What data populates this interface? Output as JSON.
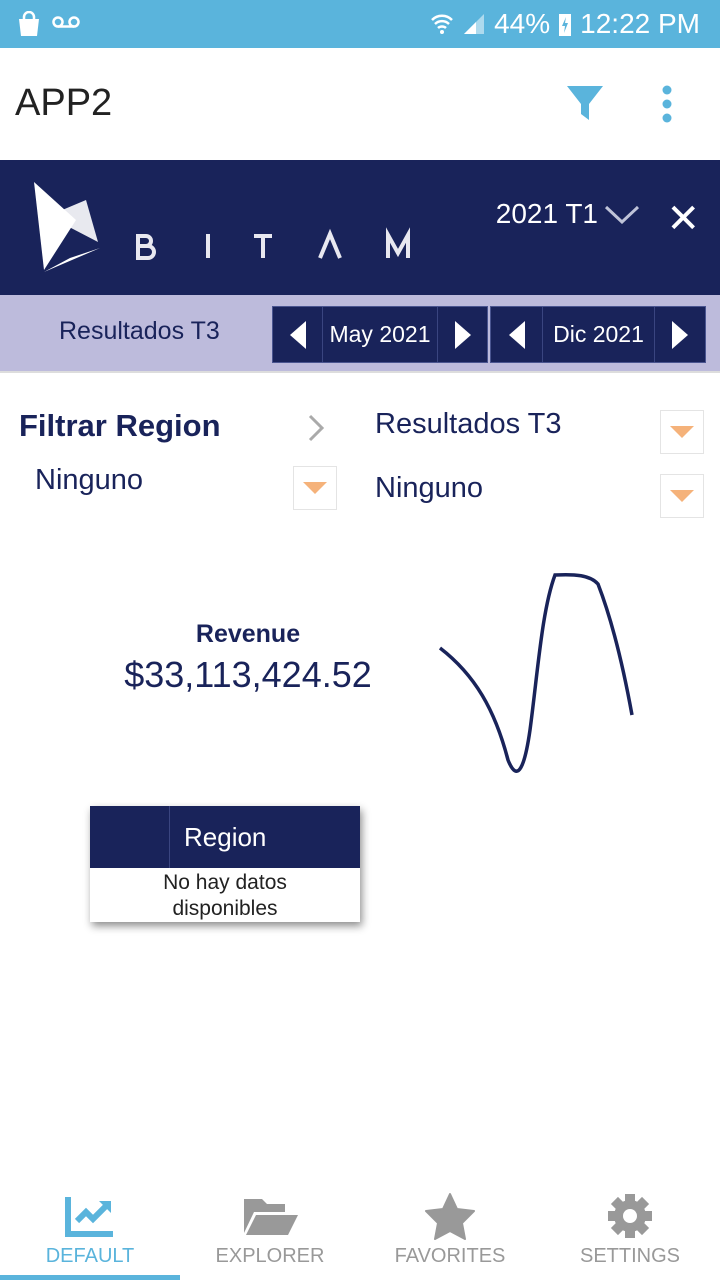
{
  "status": {
    "battery": "44%",
    "time": "12:22 PM",
    "icons": [
      "shopping-bag-icon",
      "voicemail-icon",
      "wifi-icon",
      "signal-icon",
      "battery-charging-icon"
    ]
  },
  "appbar": {
    "title": "APP2",
    "icons": [
      "filter-icon",
      "more-vert-icon"
    ]
  },
  "banner": {
    "logo_text": "BITAM",
    "period": "2021 T1"
  },
  "subbar": {
    "label": "Resultados T3",
    "start": "May 2021",
    "end": "Dic 2021"
  },
  "filters": {
    "left_title": "Filtrar Region",
    "left_value": "Ninguno",
    "right_title": "Resultados T3",
    "right_value": "Ninguno"
  },
  "kpi": {
    "label": "Revenue",
    "value": "$33,113,424.52"
  },
  "table": {
    "header": "Region",
    "empty": "No hay datos disponibles"
  },
  "tabs": [
    {
      "label": "DEFAULT",
      "icon": "chart-icon"
    },
    {
      "label": "EXPLORER",
      "icon": "folder-open-icon"
    },
    {
      "label": "FAVORITES",
      "icon": "star-icon"
    },
    {
      "label": "SETTINGS",
      "icon": "gear-icon"
    }
  ],
  "colors": {
    "navy": "#19235a",
    "accent": "#5ab4dc",
    "lavender": "#bdbbdc",
    "dropdown": "#f5b27a"
  }
}
